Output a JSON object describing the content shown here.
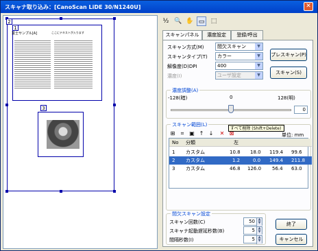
{
  "window": {
    "title": "スキャナ取り込み：[CanoScan LiDE 30/N1240U]",
    "close_glyph": "✕"
  },
  "preview": {
    "regions": [
      "1",
      "2",
      "3"
    ],
    "doc_title": "富士サンプル[A]",
    "doc_right": "ここにテキストが入ります"
  },
  "toolbar": {
    "icons": [
      "½",
      "🔍",
      "✋",
      "▭",
      "⬚"
    ]
  },
  "tabs": [
    "スキャンパネル",
    "濃度設定",
    "登録/呼出"
  ],
  "scan_settings": {
    "method_label": "スキャン方式(M)",
    "method_value": "間欠スキャン",
    "type_label": "スキャンタイプ(T)",
    "type_value": "カラー",
    "resolution_label": "解像度(D)DPI",
    "resolution_value": "400",
    "density_label": "濃度(I)",
    "density_value": "ユーザ設定",
    "prescan_button": "プレスキャン(P)",
    "scan_button": "スキャン(S)"
  },
  "density_adjust": {
    "group_label": "濃度調整(A)",
    "min_label": "-128(暗)",
    "mid_label": "0",
    "max_label": "128(明)",
    "value": "0",
    "slider_fraction": 0.5
  },
  "scan_range": {
    "group_label": "スキャン範囲(L)",
    "unit_label": "単位: mm",
    "tooltip": "すべて削除 (Shift+Delete)",
    "columns": [
      "No",
      "分類",
      "左",
      "",
      "",
      ""
    ],
    "rows": [
      {
        "no": "1",
        "type": "カスタム",
        "left": "10.8",
        "top": "18.0",
        "width": "119.4",
        "height": "99.6"
      },
      {
        "no": "2",
        "type": "カスタム",
        "left": "1.2",
        "top": "0.0",
        "width": "149.4",
        "height": "211.8"
      },
      {
        "no": "3",
        "type": "カスタム",
        "left": "46.8",
        "top": "126.0",
        "width": "56.4",
        "height": "63.0"
      }
    ]
  },
  "interval_scan": {
    "group_label": "間欠スキャン設定",
    "count_label": "スキャン回数(C)",
    "count_value": "50",
    "delay_label": "スキャナ起動遅延秒数(B)",
    "delay_value": "5",
    "interval_label": "間隔秒数(I)",
    "interval_value": "5"
  },
  "buttons": {
    "finish": "終了",
    "cancel": "キャンセル"
  }
}
